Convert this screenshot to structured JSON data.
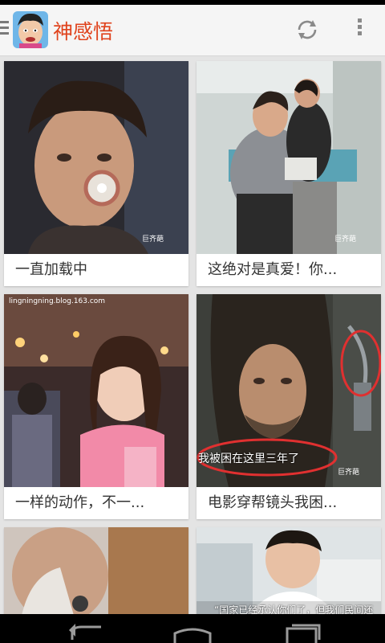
{
  "app": {
    "title": "神感悟",
    "brand_color": "#e0431d"
  },
  "actions": {
    "drawer_icon": "hamburger-icon",
    "refresh_icon": "refresh-icon",
    "overflow_icon": "overflow-menu-icon"
  },
  "feed": {
    "cards": [
      {
        "caption": "一直加载中",
        "watermark": "巨齐葩"
      },
      {
        "caption": "这绝对是真爱！你...",
        "watermark": "巨齐葩"
      },
      {
        "caption": "一样的动作，不一...",
        "watermark": "lingningning.blog.163.com"
      },
      {
        "caption": "电影穿帮镜头我困...",
        "watermark": "巨齐葩",
        "image_subtitle": "我被困在这里三年了"
      },
      {
        "caption": "",
        "watermark": ""
      },
      {
        "caption": "",
        "image_subtitle": "“国家已经承认你们了，但我们民间还"
      }
    ]
  },
  "navigation": {
    "back_icon": "back-icon",
    "home_icon": "home-icon",
    "recents_icon": "recents-icon"
  }
}
